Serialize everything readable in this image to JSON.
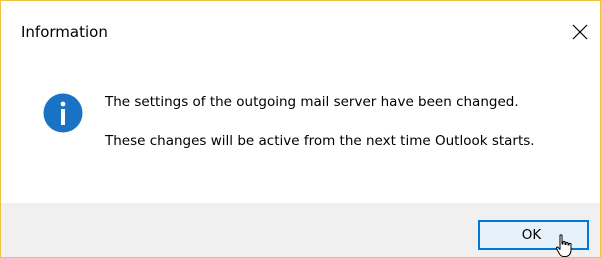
{
  "window": {
    "title": "Information",
    "border_color": "#f0c23d"
  },
  "icons": {
    "close": "close-icon",
    "info": "info-icon",
    "cursor": "hand-pointer-icon"
  },
  "message": {
    "line1": "The settings of the outgoing mail server have been changed.",
    "line2": "These changes will be active from the next time Outlook starts."
  },
  "buttons": {
    "ok_label": "OK"
  },
  "colors": {
    "info_icon": "#1a72c4",
    "button_border": "#0078d7",
    "button_fill": "#e5f1fb",
    "footer_bg": "#f0f0f0"
  }
}
